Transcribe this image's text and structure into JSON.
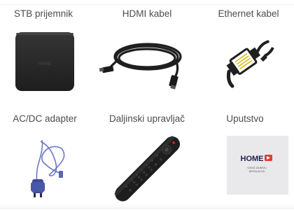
{
  "items": [
    {
      "label": "STB prijemnik",
      "icon": "stb-receiver-icon"
    },
    {
      "label": "HDMI kabel",
      "icon": "hdmi-cable-icon"
    },
    {
      "label": "Ethernet kabel",
      "icon": "ethernet-cable-icon"
    },
    {
      "label": "AC/DC adapter",
      "icon": "power-adapter-icon"
    },
    {
      "label": "Daljinski upravljač",
      "icon": "remote-control-icon"
    },
    {
      "label": "Uputstvo",
      "icon": "manual-icon"
    }
  ],
  "manual": {
    "brand": "HOME",
    "subtitle_line1": "VODIČ ZA BRZU",
    "subtitle_line2": "INSTALACIJU"
  },
  "stb": {
    "brand": "HOME"
  },
  "colors": {
    "accent": "#e53935",
    "device": "#2b2b2b",
    "adapter_cable": "#6b78c8",
    "text": "#4d4d4d"
  }
}
